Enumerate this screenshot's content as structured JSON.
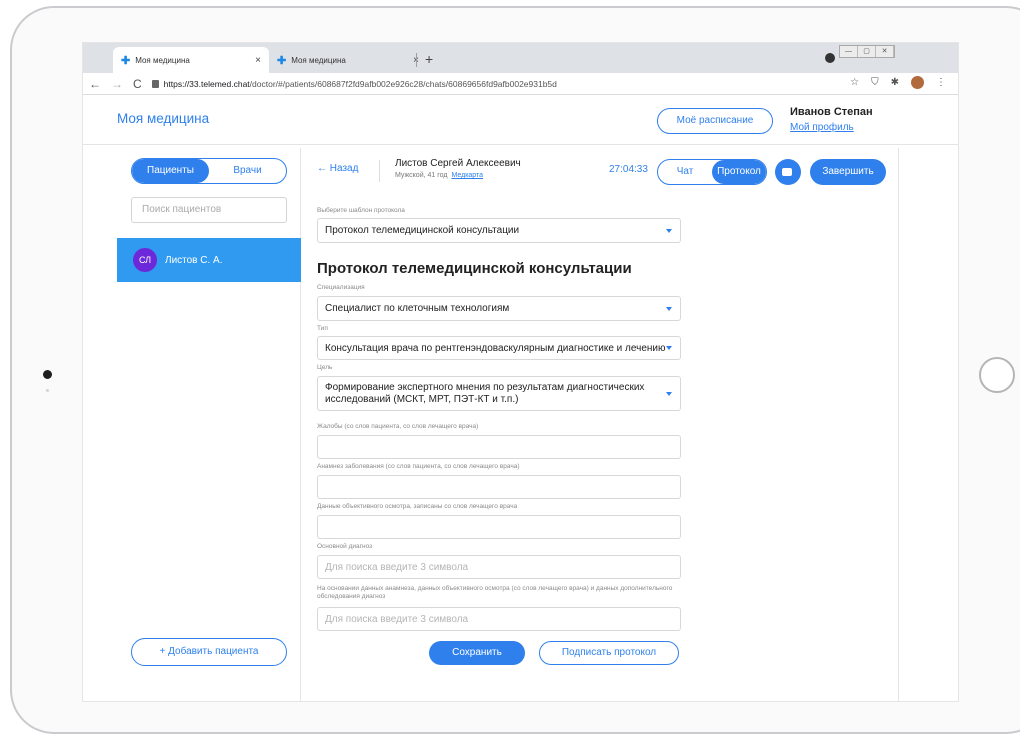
{
  "browser": {
    "tabs": [
      {
        "label": "Моя медицина",
        "close": "×"
      },
      {
        "label": "Моя медицина",
        "close": "×"
      }
    ],
    "new_tab": "+",
    "url_host": "https://33.telemed.chat",
    "url_path": "/doctor/#/patients/608687f2fd9afb002e926c28/chats/60869656fd9afb002e931b5d",
    "back": "←",
    "forward": "→",
    "reload": "C",
    "icons": [
      "star-icon",
      "shield-icon",
      "extensions-icon",
      "avatar",
      "menu-icon"
    ]
  },
  "header": {
    "brand": "Моя медицина",
    "schedule_button": "Моё расписание",
    "user_name": "Иванов Степан",
    "profile_link": "Мой профиль"
  },
  "sidebar": {
    "tab_patients": "Пациенты",
    "tab_doctors": "Врачи",
    "search_placeholder": "Поиск пациентов",
    "patients": [
      {
        "initials": "СЛ",
        "name": "Листов С. А."
      }
    ],
    "add_patient": "+ Добавить пациента"
  },
  "consult": {
    "back": "← Назад",
    "patient_name": "Листов Сергей Алексеевич",
    "patient_info": "Мужской, 41 год",
    "medcard_link": "Медкарта",
    "timer": "27:04:33",
    "toggle_chat": "Чат",
    "toggle_protocol": "Протокол",
    "finish_button": "Завершить"
  },
  "form": {
    "template_label": "Выберите шаблон протокола",
    "template_value": "Протокол телемедицинской консультации",
    "title": "Протокол телемедицинской консультации",
    "spec_label": "Специализация",
    "spec_value": "Специалист по клеточным технологиям",
    "type_label": "Тип",
    "type_value": "Консультация врача по рентгенэндоваскулярным диагностике и лечению",
    "goal_label": "Цель",
    "goal_value": "Формирование экспертного мнения по результатам диагностических исследований (МСКТ, МРТ, ПЭТ-КТ и т.п.)",
    "complaints_label": "Жалобы (со слов пациента, со слов лечащего врача)",
    "anamnesis_label": "Анамнез заболевания (со слов пациента, со слов лечащего врача)",
    "exam_label": "Данные объективного осмотра, записаны со слов лечащего врача",
    "diagnosis_label": "Основной диагноз",
    "diagnosis_placeholder": "Для поиска введите 3 символа",
    "extra_label": "На основании данных анамнеза, данных объективного осмотра (со слов лечащего врача) и данных дополнительного обследования диагноз",
    "extra_placeholder": "Для поиска введите 3 символа",
    "save_button": "Сохранить",
    "sign_button": "Подписать протокол"
  },
  "colors": {
    "accent": "#2f80ed",
    "selected_row": "#2f9af0",
    "avatar": "#6d28d9"
  }
}
